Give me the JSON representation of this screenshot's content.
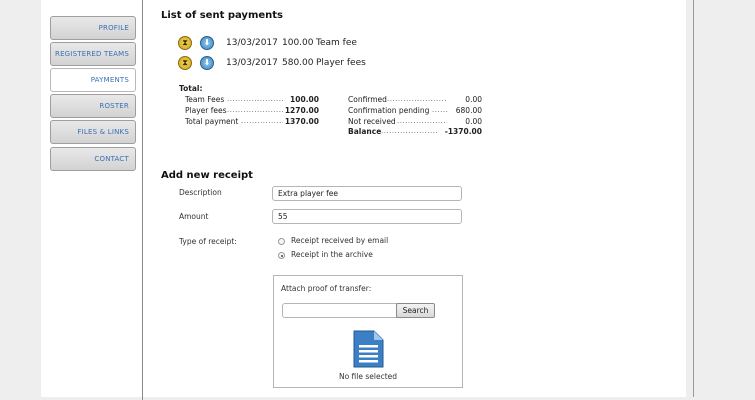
{
  "sidebar": {
    "items": [
      {
        "label": "PROFILE"
      },
      {
        "label": "REGISTERED TEAMS"
      },
      {
        "label": "PAYMENTS"
      },
      {
        "label": "ROSTER"
      },
      {
        "label": "FILES & LINKS"
      },
      {
        "label": "CONTACT"
      }
    ],
    "active": "PAYMENTS"
  },
  "payments": {
    "title": "List of sent payments",
    "rows": [
      {
        "date": "13/03/2017",
        "amount": "100.00",
        "description": "Team fee",
        "status_icon": "hourglass-icon",
        "action_icon": "download-icon"
      },
      {
        "date": "13/03/2017",
        "amount": "580.00",
        "description": "Player fees",
        "status_icon": "hourglass-icon",
        "action_icon": "download-icon"
      }
    ]
  },
  "totals": {
    "title": "Total:",
    "left": [
      {
        "label": "Team Fees",
        "value": "100.00"
      },
      {
        "label": "Player fees",
        "value": "1270.00"
      },
      {
        "label": "Total payment",
        "value": "1370.00"
      }
    ],
    "right": [
      {
        "label": "Confirmed",
        "value": "0.00"
      },
      {
        "label": "Confirmation pending",
        "value": "680.00"
      },
      {
        "label": "Not received",
        "value": "0.00"
      },
      {
        "label": "Balance",
        "value": "-1370.00"
      }
    ]
  },
  "receipt": {
    "title": "Add new receipt",
    "description_label": "Description",
    "description_value": "Extra player fee",
    "amount_label": "Amount",
    "amount_value": "55",
    "type_label": "Type of receipt:",
    "options": [
      {
        "label": "Receipt received by email",
        "selected": false
      },
      {
        "label": "Receipt in the archive",
        "selected": true
      }
    ],
    "attach_label": "Attach proof of transfer:",
    "search_label": "Search",
    "no_file_text": "No file selected"
  },
  "colors": {
    "link": "#3a6fb5",
    "icon_gold": "#e2c13a",
    "icon_blue": "#3a86c3"
  }
}
